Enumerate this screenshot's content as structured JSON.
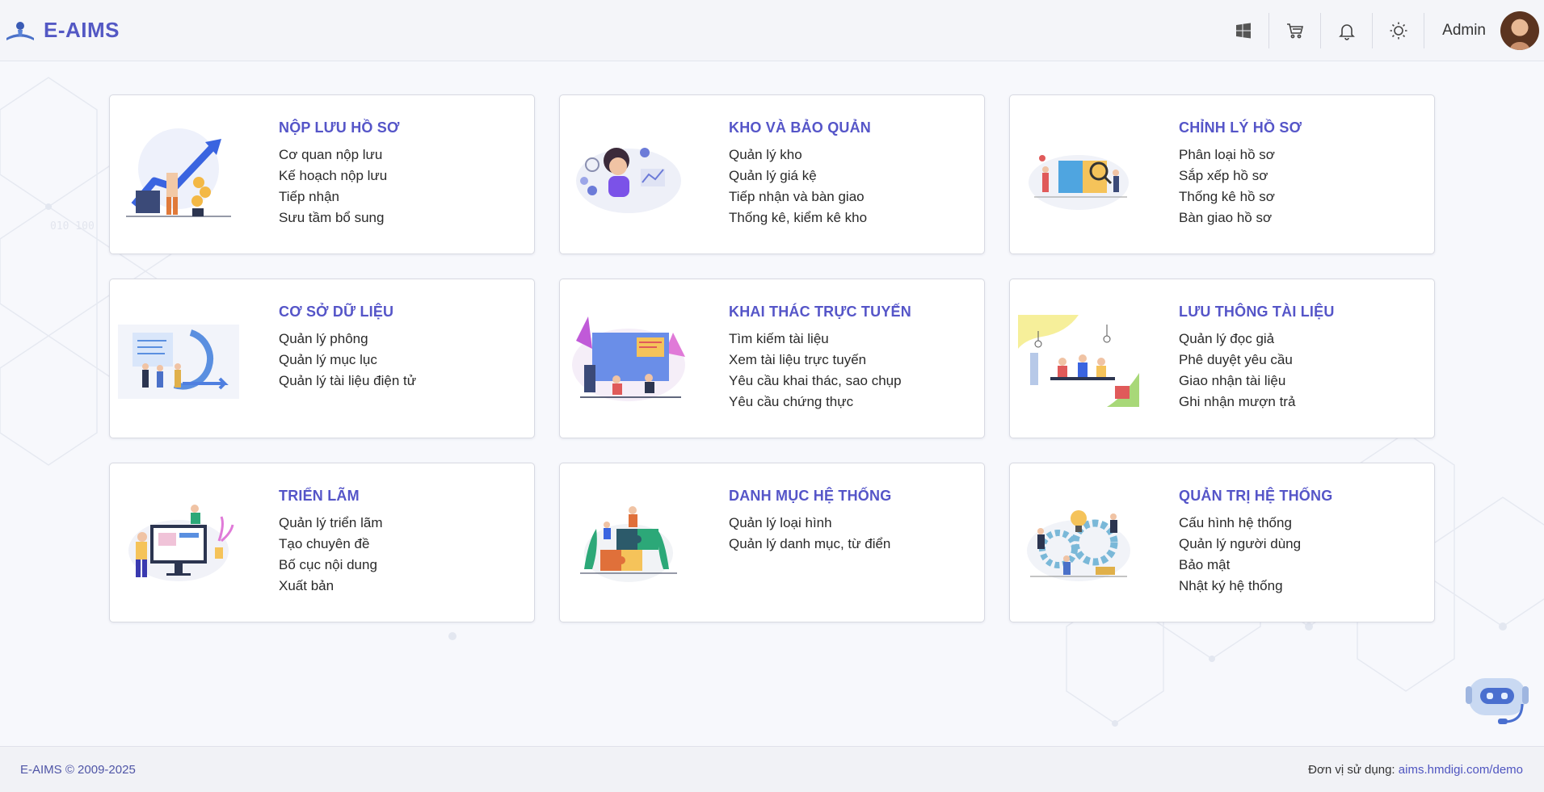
{
  "app": {
    "name": "E-AIMS"
  },
  "header": {
    "icons": [
      "windows-icon",
      "cart-icon",
      "bell-icon",
      "sun-icon"
    ],
    "user": "Admin"
  },
  "cards": [
    {
      "title": "NỘP LƯU HỒ SƠ",
      "items": [
        "Cơ quan nộp lưu",
        "Kế hoạch nộp lưu",
        "Tiếp nhận",
        "Sưu tầm bổ sung"
      ]
    },
    {
      "title": "KHO VÀ BẢO QUẢN",
      "items": [
        "Quản lý kho",
        "Quản lý giá kệ",
        "Tiếp nhận và bàn giao",
        "Thống kê, kiểm kê kho"
      ]
    },
    {
      "title": "CHỈNH LÝ HỒ SƠ",
      "items": [
        "Phân loại hồ sơ",
        "Sắp xếp hồ sơ",
        "Thống kê hồ sơ",
        "Bàn giao hồ sơ"
      ]
    },
    {
      "title": "CƠ SỞ DỮ LIỆU",
      "items": [
        "Quản lý phông",
        "Quản lý mục lục",
        "Quản lý tài liệu điện tử"
      ]
    },
    {
      "title": "KHAI THÁC TRỰC TUYẾN",
      "items": [
        "Tìm kiếm tài liệu",
        "Xem tài liệu trực tuyến",
        "Yêu cầu khai thác, sao chụp",
        "Yêu cầu chứng thực"
      ]
    },
    {
      "title": "LƯU THÔNG TÀI LIỆU",
      "items": [
        "Quản lý đọc giả",
        "Phê duyệt yêu cầu",
        "Giao nhận tài liệu",
        "Ghi nhận mượn trả"
      ]
    },
    {
      "title": "TRIỂN LÃM",
      "items": [
        "Quản lý triển lãm",
        "Tạo chuyên đề",
        "Bố cục nội dung",
        "Xuất bản"
      ]
    },
    {
      "title": "DANH MỤC HỆ THỐNG",
      "items": [
        "Quản lý loại hình",
        "Quản lý danh mục, từ điển"
      ]
    },
    {
      "title": "QUẢN TRỊ HỆ THỐNG",
      "items": [
        "Cấu hình hệ thống",
        "Quản lý người dùng",
        "Bảo mật",
        "Nhật ký hệ thống"
      ]
    }
  ],
  "footer": {
    "copyright": "E-AIMS © 2009-2025",
    "usage_label": "Đơn vị sử dụng:",
    "usage_link": "aims.hmdigi.com/demo"
  },
  "colors": {
    "accent": "#5555c8",
    "link": "#4f55c0"
  }
}
